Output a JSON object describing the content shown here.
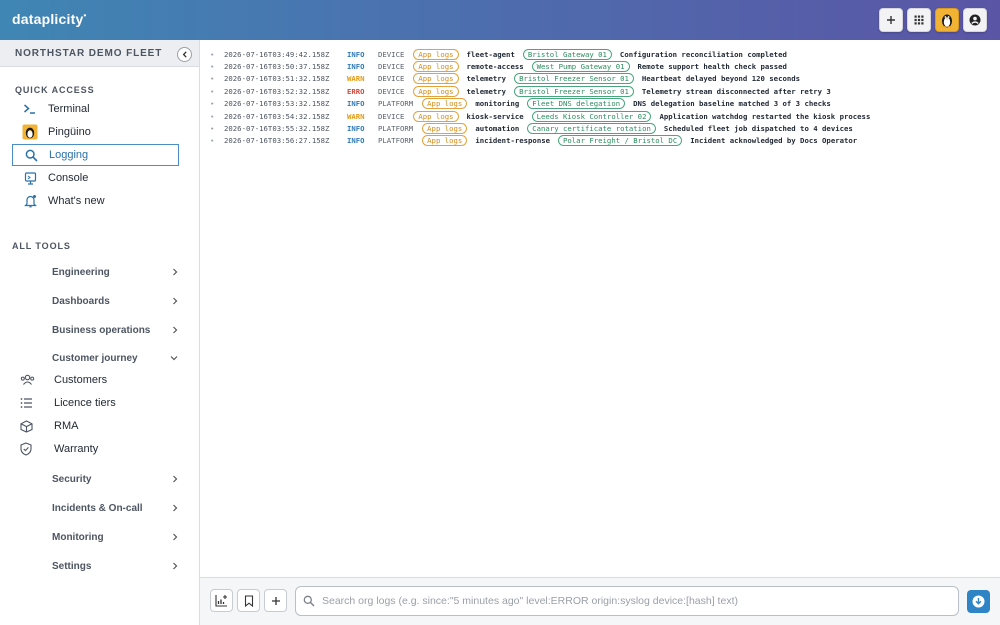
{
  "brand": {
    "name": "dataplicity",
    "mark": "•"
  },
  "sidebar": {
    "fleet_name": "NORTHSTAR DEMO FLEET",
    "quick_access_label": "QUICK ACCESS",
    "quick_access": [
      {
        "label": "Terminal",
        "icon": "terminal-icon"
      },
      {
        "label": "Pingüino",
        "icon": "penguin-icon"
      },
      {
        "label": "Logging",
        "icon": "search-icon"
      },
      {
        "label": "Console",
        "icon": "monitor-icon"
      },
      {
        "label": "What's new",
        "icon": "bell-icon"
      }
    ],
    "all_tools_label": "ALL TOOLS",
    "tools_top": [
      "Engineering",
      "Dashboards",
      "Business operations",
      "Customer journey"
    ],
    "customer_journey": [
      {
        "label": "Customers",
        "icon": "users-icon"
      },
      {
        "label": "Licence tiers",
        "icon": "list-icon"
      },
      {
        "label": "RMA",
        "icon": "box-icon"
      },
      {
        "label": "Warranty",
        "icon": "shield-icon"
      }
    ],
    "tools_bottom": [
      "Security",
      "Incidents & On-call",
      "Monitoring",
      "Settings"
    ]
  },
  "logs": [
    {
      "ts": "2026-07-16T03:49:42.158Z",
      "level": "INFO",
      "source": "DEVICE",
      "tag": "App logs",
      "service": "fleet-agent",
      "device": "Bristol Gateway 01",
      "message": "Configuration reconciliation completed"
    },
    {
      "ts": "2026-07-16T03:50:37.158Z",
      "level": "INFO",
      "source": "DEVICE",
      "tag": "App logs",
      "service": "remote-access",
      "device": "West Pump Gateway 01",
      "message": "Remote support health check passed"
    },
    {
      "ts": "2026-07-16T03:51:32.158Z",
      "level": "WARN",
      "source": "DEVICE",
      "tag": "App logs",
      "service": "telemetry",
      "device": "Bristol Freezer Sensor 01",
      "message": "Heartbeat delayed beyond 120 seconds"
    },
    {
      "ts": "2026-07-16T03:52:32.158Z",
      "level": "ERRO",
      "source": "DEVICE",
      "tag": "App logs",
      "service": "telemetry",
      "device": "Bristol Freezer Sensor 01",
      "message": "Telemetry stream disconnected after retry 3"
    },
    {
      "ts": "2026-07-16T03:53:32.158Z",
      "level": "INFO",
      "source": "PLATFORM",
      "tag": "App logs",
      "service": "monitoring",
      "device": "Fleet DNS delegation",
      "message": "DNS delegation baseline matched 3 of 3 checks"
    },
    {
      "ts": "2026-07-16T03:54:32.158Z",
      "level": "WARN",
      "source": "DEVICE",
      "tag": "App logs",
      "service": "kiosk-service",
      "device": "Leeds Kiosk Controller 02",
      "message": "Application watchdog restarted the kiosk process"
    },
    {
      "ts": "2026-07-16T03:55:32.158Z",
      "level": "INFO",
      "source": "PLATFORM",
      "tag": "App logs",
      "service": "automation",
      "device": "Canary certificate rotation",
      "message": "Scheduled fleet job dispatched to 4 devices"
    },
    {
      "ts": "2026-07-16T03:56:27.158Z",
      "level": "INFO",
      "source": "PLATFORM",
      "tag": "App logs",
      "service": "incident-response",
      "device": "Polar Freight / Bristol DC",
      "message": "Incident acknowledged by Docs Operator"
    }
  ],
  "search": {
    "value": "",
    "placeholder": "Search org logs (e.g. since:\"5 minutes ago\" level:ERROR origin:syslog device:[hash] text)"
  },
  "colors": {
    "info": "#2f7ab8",
    "warn": "#e39b12",
    "error": "#d3463a",
    "app_tag": "#e3a23c",
    "device_tag": "#4aa67c"
  }
}
